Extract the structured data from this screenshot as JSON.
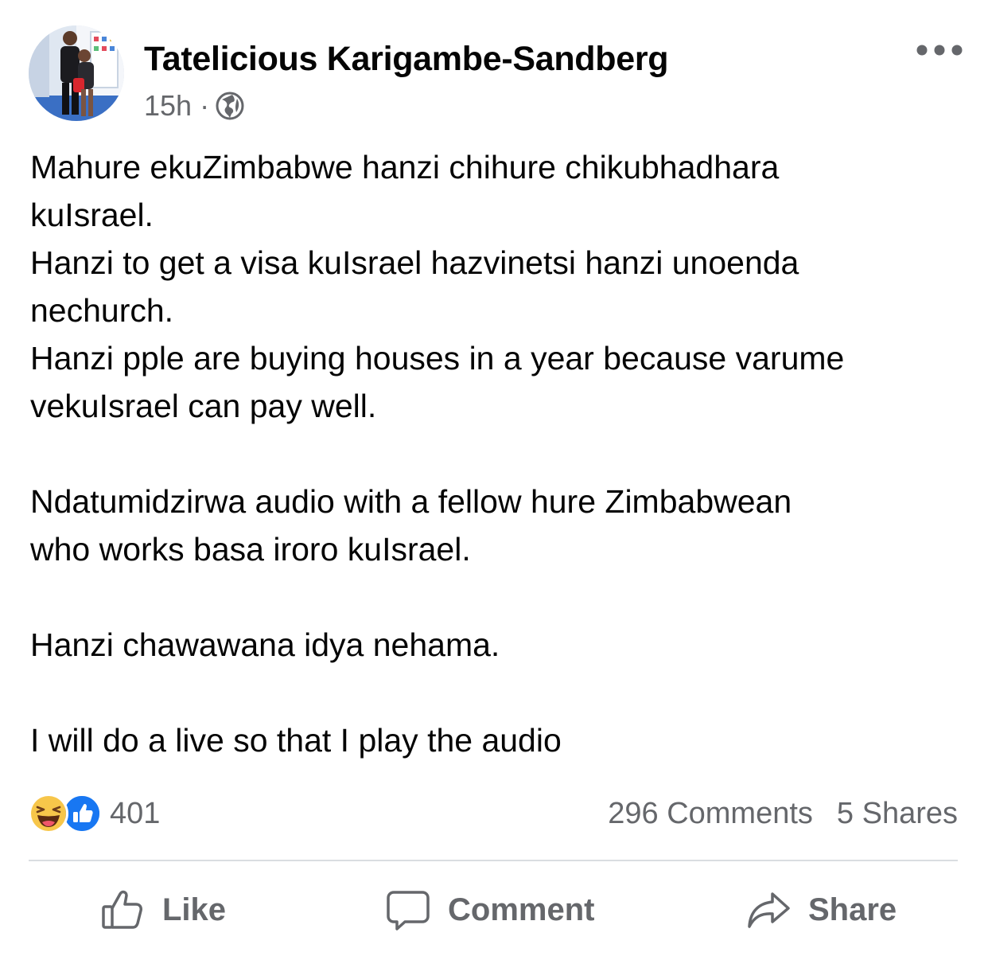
{
  "post": {
    "author": "Tatelicious Karigambe-Sandberg",
    "time": "15h",
    "separator": "·",
    "paragraphs": [
      [
        "Mahure ekuZimbabwe hanzi chihure chikubhadhara",
        "kuIsrael.",
        "Hanzi to get a visa kuIsrael hazvinetsi hanzi unoenda",
        "nechurch.",
        "Hanzi pple are buying houses in a year because varume",
        "vekuIsrael can pay well."
      ],
      [
        "Ndatumidzirwa audio with a fellow hure Zimbabwean",
        "who works basa iroro kuIsrael."
      ],
      [
        "Hanzi chawawana idya nehama."
      ],
      [
        "I will do a live so that I play the audio"
      ]
    ]
  },
  "stats": {
    "reaction_count": "401",
    "comments": "296 Comments",
    "shares": "5 Shares"
  },
  "actions": {
    "like": "Like",
    "comment": "Comment",
    "share": "Share"
  },
  "icons": {
    "avatar": "avatar",
    "privacy": "globe-icon",
    "more": "more-options-icon",
    "reaction_1": "haha-reaction-icon",
    "reaction_2": "like-reaction-icon",
    "like": "thumbs-up-icon",
    "comment": "comment-icon",
    "share": "share-arrow-icon"
  },
  "colors": {
    "text": "#050505",
    "secondary": "#65676b",
    "divider": "#dadde1",
    "like_blue": "#1877f2",
    "haha_yellow": "#f7c64a"
  }
}
